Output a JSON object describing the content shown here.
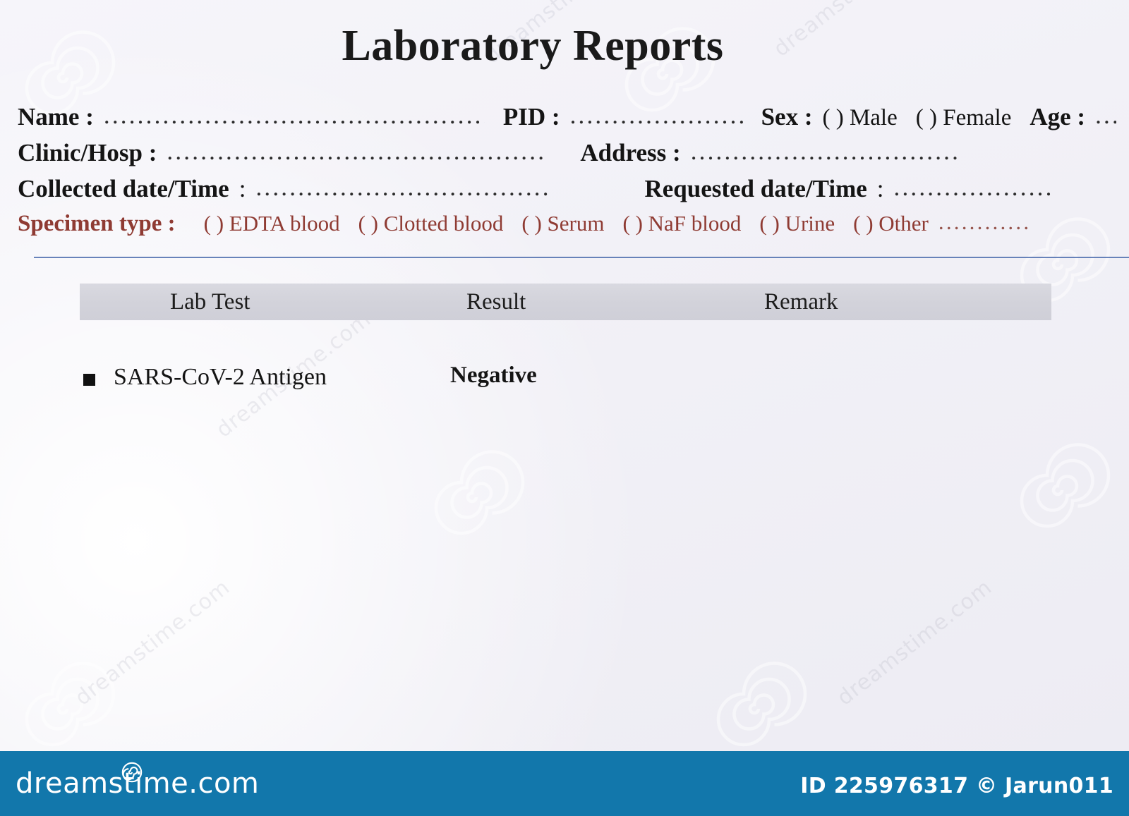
{
  "document": {
    "title": "Laboratory Reports",
    "background_color": "#f4f3f8",
    "accent_color": "#8f3b33",
    "rule_color": "#4f6fae"
  },
  "form": {
    "name_label": "Name :",
    "name_dots": "................................................",
    "pid_label": "PID :",
    "pid_dots": ".......................",
    "sex_label": "Sex :",
    "sex_option_male": "( ) Male",
    "sex_option_female": "( ) Female",
    "age_label": "Age :",
    "age_dots": "....",
    "clinic_label": "Clinic/Hosp :",
    "clinic_dots": ".............................................",
    "address_label": "Address :",
    "address_dots": "................................",
    "collected_label": "Collected date/Time",
    "collected_colon": ":",
    "collected_dots": "...................................",
    "requested_label": "Requested date/Time",
    "requested_colon": ":",
    "requested_dots": "...................",
    "specimen_label": "Specimen type :",
    "specimen_options": [
      "( ) EDTA blood",
      "( ) Clotted blood",
      "( ) Serum",
      "( ) NaF blood",
      "( ) Urine",
      "( ) Other"
    ],
    "specimen_other_dots": "............"
  },
  "table": {
    "headers": {
      "test": "Lab Test",
      "result": "Result",
      "remark": "Remark"
    },
    "rows": [
      {
        "test": "SARS-CoV-2  Antigen",
        "result": "Negative",
        "remark": ""
      }
    ]
  },
  "watermark": {
    "brand": "dreamstime.com",
    "credit": "ID 225976317 © Jarun011",
    "bar_color": "#1277ab"
  }
}
